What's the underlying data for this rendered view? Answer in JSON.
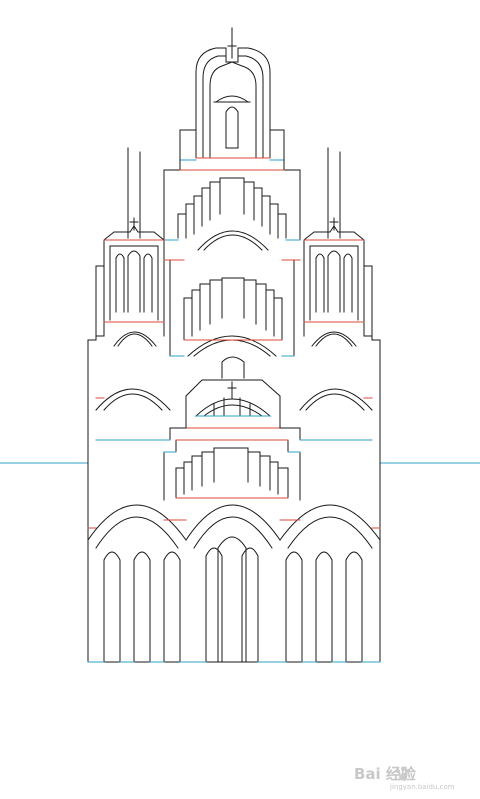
{
  "palette": {
    "cut": "#1a1a1a",
    "mountain_fold": "#d94a3a",
    "valley_fold": "#2fa0c8",
    "background": "#ffffff"
  },
  "watermark": {
    "brand": "Bai 经验",
    "url": "jingyan.baidu.com"
  }
}
